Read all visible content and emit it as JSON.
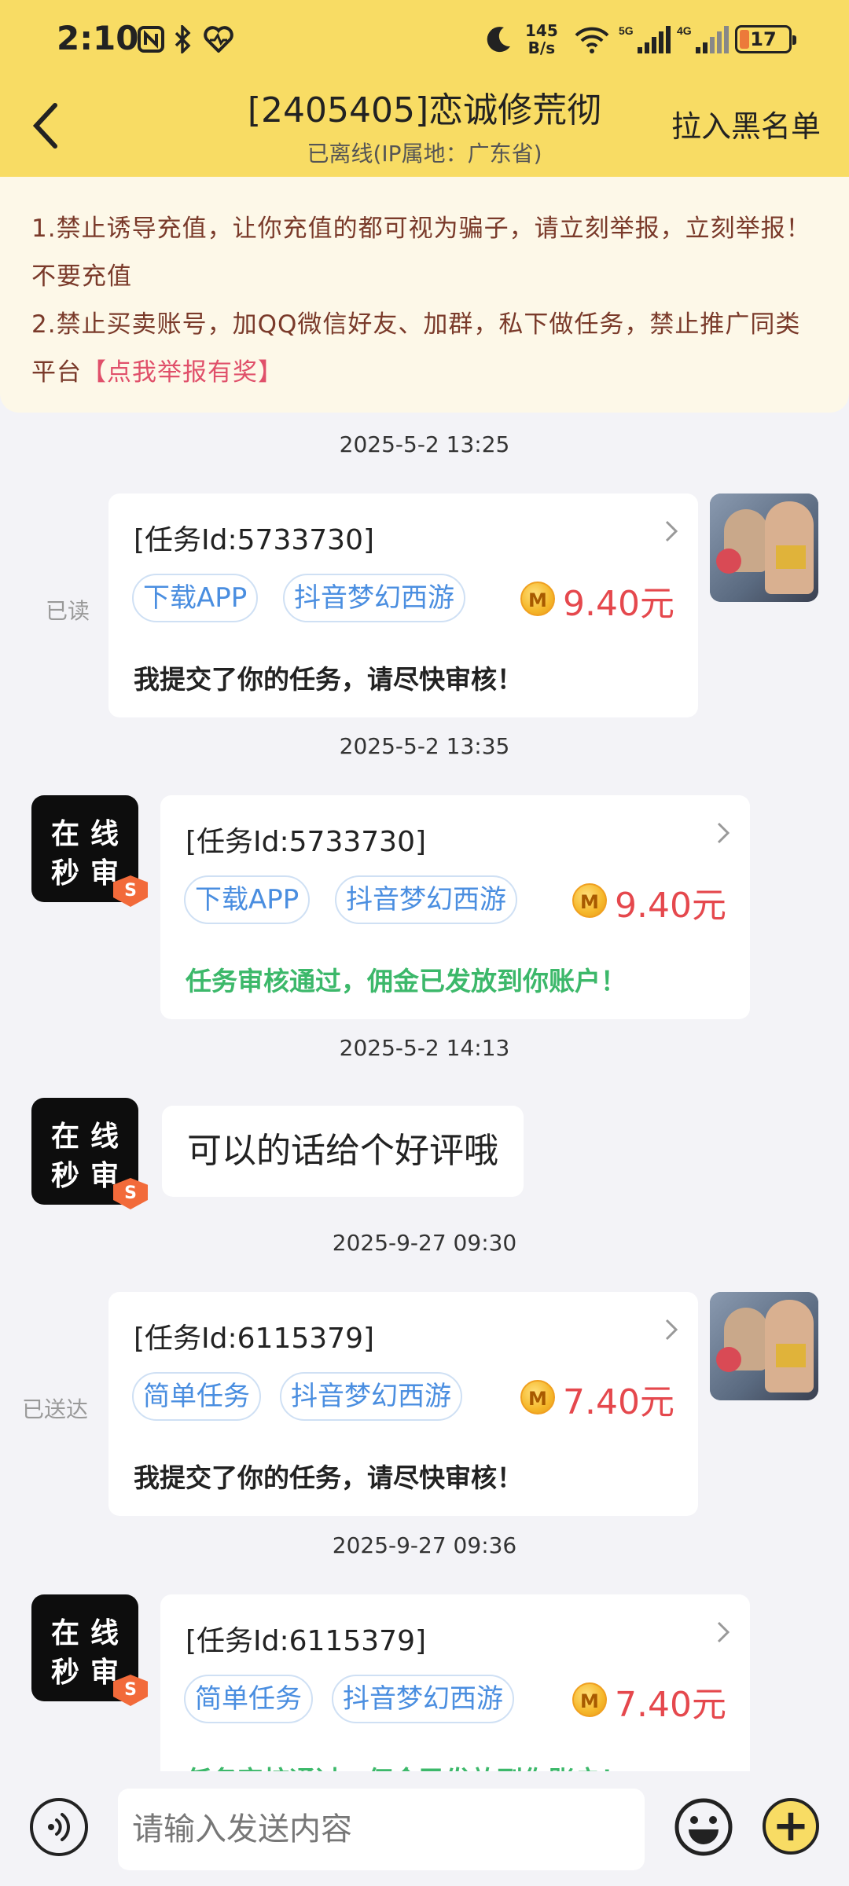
{
  "status_bar": {
    "time": "2:10",
    "net_speed_value": "145",
    "net_speed_unit": "B/s",
    "battery_level": "17",
    "icons": [
      "nfc-icon",
      "bluetooth-icon",
      "heart-rate-icon",
      "moon-icon",
      "wifi-icon",
      "signal-5g-icon",
      "signal-4g-icon",
      "battery-icon"
    ]
  },
  "header": {
    "title": "[2405405]恋诚修荒彻",
    "subtitle": "已离线(IP属地：广东省)",
    "blacklist_label": "拉入黑名单",
    "background": "#f8dc64"
  },
  "notice": {
    "line1": "1.禁止诱导充值，让你充值的都可视为骗子，请立刻举报，立刻举报！不要充值",
    "line2": "2.禁止买卖账号，加QQ微信好友、加群，私下做任务，禁止推广同类平台",
    "report_link": "【点我举报有奖】"
  },
  "system_avatar": {
    "line1": "在线",
    "line2": "秒审",
    "badge": "S"
  },
  "messages": [
    {
      "timestamp": "2025-5-2 13:25",
      "sender": "me",
      "status": "已读",
      "task_id": "[任务Id:5733730]",
      "tags": [
        "下载APP",
        "抖音梦幻西游"
      ],
      "coin": "M",
      "price": "9.40元",
      "message": "我提交了你的任务，请尽快审核！"
    },
    {
      "timestamp": "2025-5-2 13:35",
      "sender": "system",
      "task_id": "[任务Id:5733730]",
      "tags": [
        "下载APP",
        "抖音梦幻西游"
      ],
      "coin": "M",
      "price": "9.40元",
      "message": "任务审核通过，佣金已发放到你账户！"
    },
    {
      "timestamp": "2025-5-2 14:13",
      "sender": "system",
      "text": "可以的话给个好评哦"
    },
    {
      "timestamp": "2025-9-27 09:30",
      "sender": "me",
      "status": "已送达",
      "task_id": "[任务Id:6115379]",
      "tags": [
        "简单任务",
        "抖音梦幻西游"
      ],
      "coin": "M",
      "price": "7.40元",
      "message": "我提交了你的任务，请尽快审核！"
    },
    {
      "timestamp": "2025-9-27 09:36",
      "sender": "system",
      "task_id": "[任务Id:6115379]",
      "tags": [
        "简单任务",
        "抖音梦幻西游"
      ],
      "coin": "M",
      "price": "7.40元",
      "message": "任务审核通过，佣金已发放到你账户！"
    }
  ],
  "input_bar": {
    "placeholder": "请输入发送内容",
    "plus_label": "+"
  },
  "colors": {
    "price": "#e5484d",
    "tag_text": "#4a8ee0",
    "approved": "#3cb86a",
    "notice_text": "#7a3a2a",
    "report_link": "#e0506a"
  }
}
